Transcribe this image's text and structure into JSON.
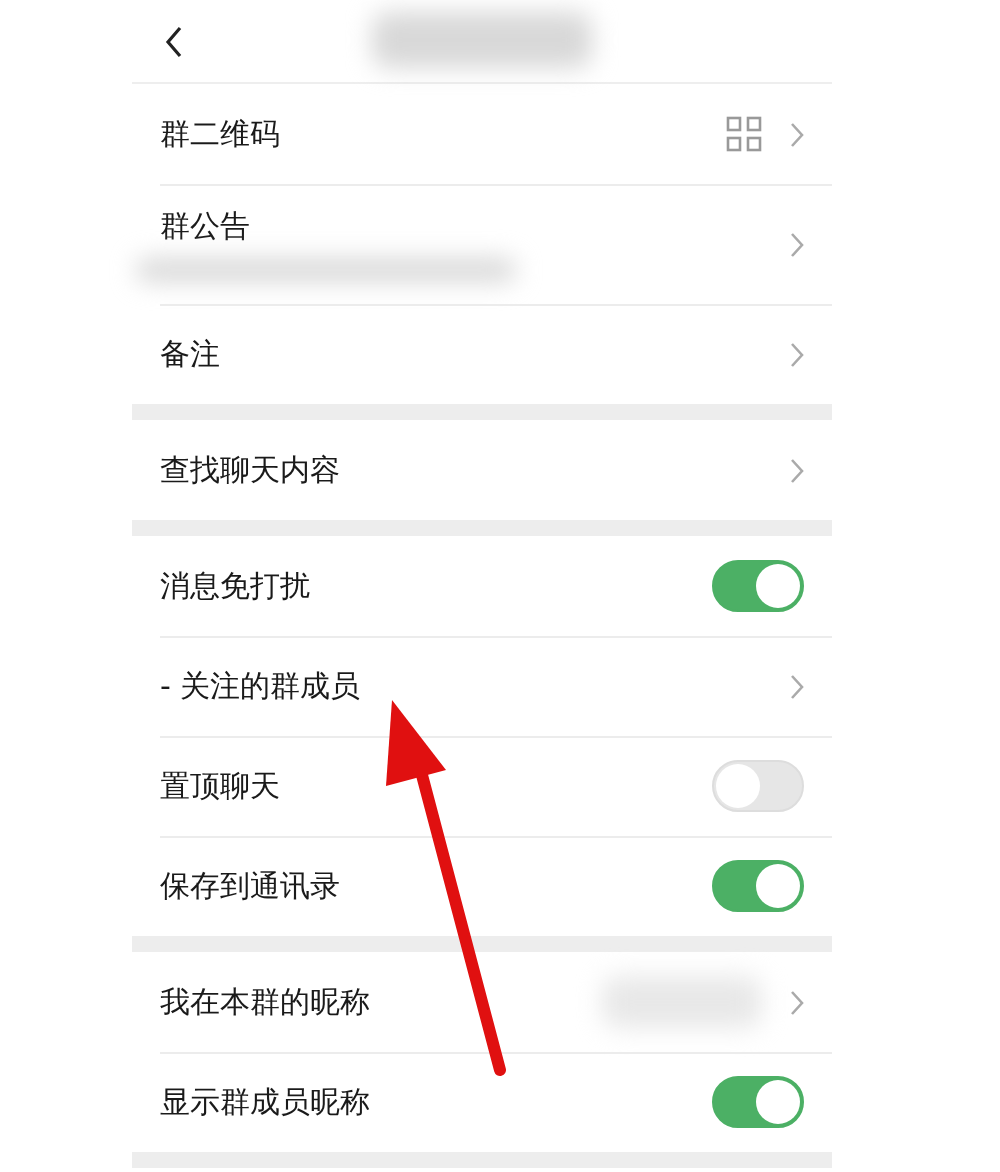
{
  "header": {
    "back_button": true
  },
  "sections": [
    {
      "rows": [
        {
          "kind": "link",
          "label": "群二维码",
          "qr_code": true
        },
        {
          "kind": "link",
          "label": "群公告",
          "blurred_detail": true
        },
        {
          "kind": "link",
          "label": "备注"
        }
      ]
    },
    {
      "rows": [
        {
          "kind": "link",
          "label": "查找聊天内容"
        }
      ]
    },
    {
      "rows": [
        {
          "kind": "toggle",
          "label": "消息免打扰",
          "on": true
        },
        {
          "kind": "link",
          "label": "- 关注的群成员"
        },
        {
          "kind": "toggle",
          "label": "置顶聊天",
          "on": false
        },
        {
          "kind": "toggle",
          "label": "保存到通讯录",
          "on": true
        }
      ]
    },
    {
      "rows": [
        {
          "kind": "link",
          "label": "我在本群的昵称",
          "blurred_value": true
        },
        {
          "kind": "toggle",
          "label": "显示群成员昵称",
          "on": true
        }
      ]
    }
  ],
  "annotation": {
    "kind": "arrow"
  }
}
